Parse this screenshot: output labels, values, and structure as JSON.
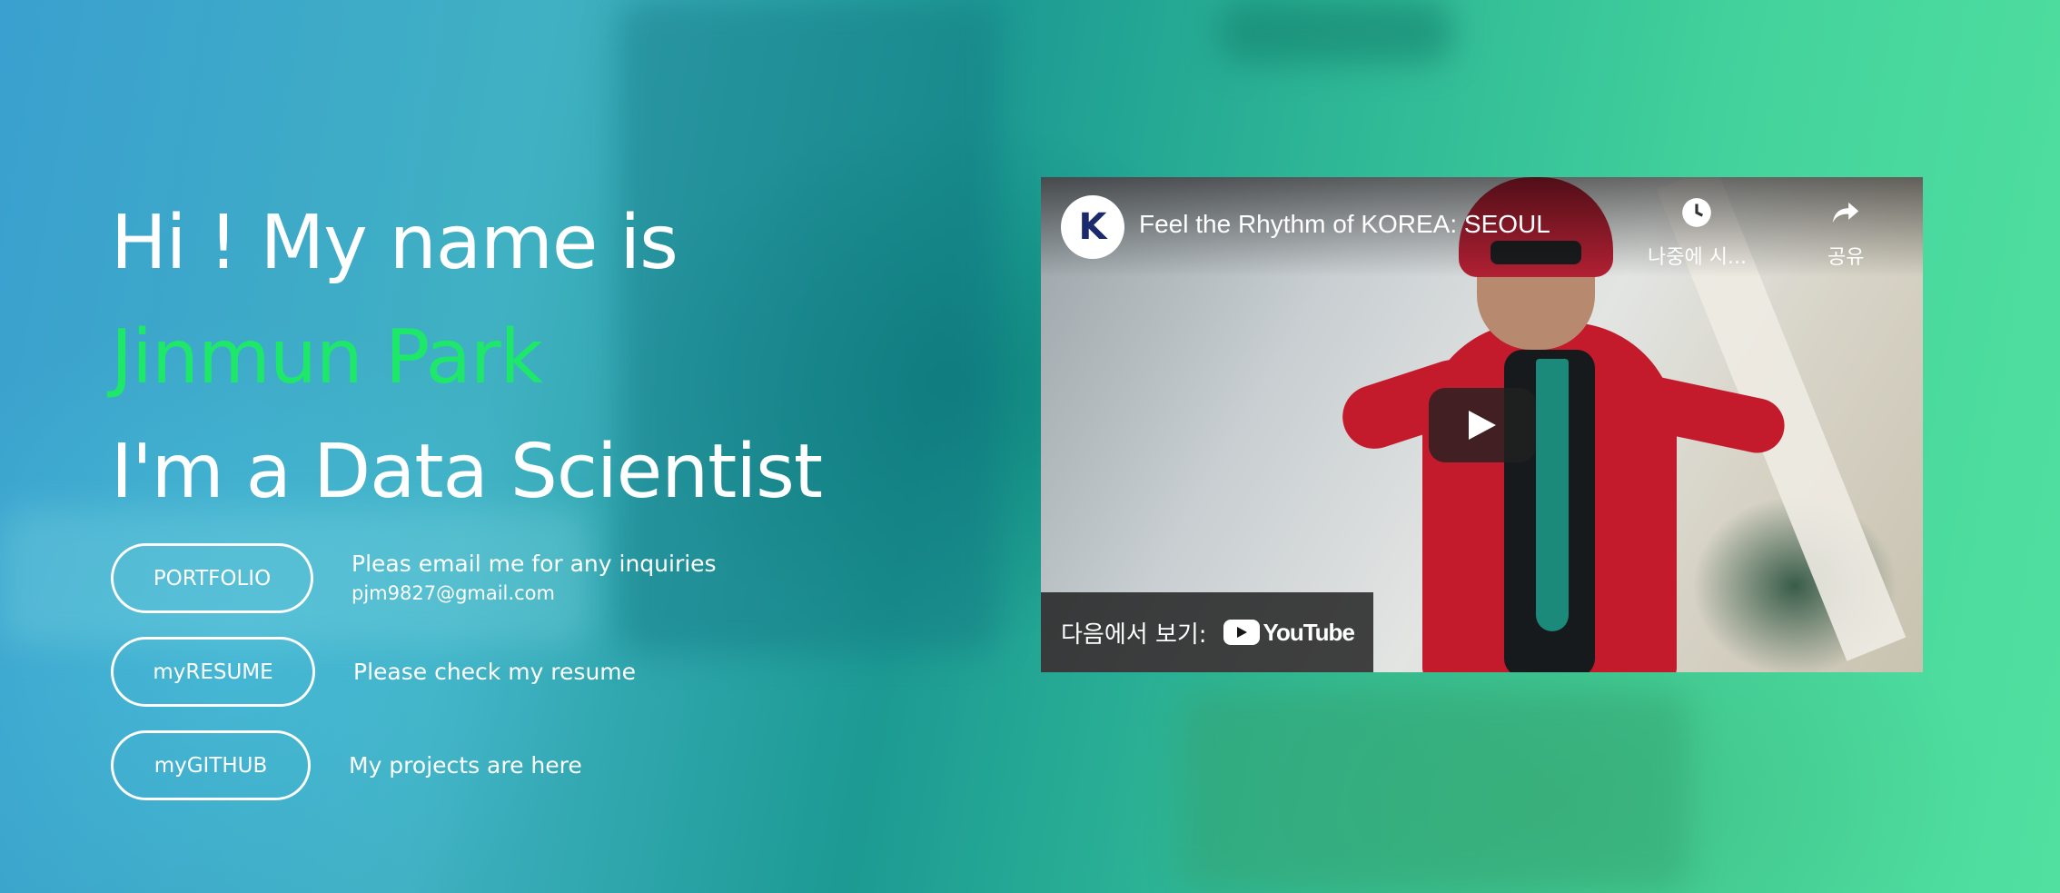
{
  "hero": {
    "greeting": "Hi ! My name is",
    "name": "Jinmun Park",
    "role": "I'm a Data Scientist"
  },
  "actions": [
    {
      "button": "PORTFOLIO",
      "text": "Pleas email me for any inquiries",
      "email": "pjm9827@gmail.com"
    },
    {
      "button": "myRESUME",
      "text": "Please check my resume"
    },
    {
      "button": "myGITHUB",
      "text": "My projects are here"
    }
  ],
  "video": {
    "channel_initial": "K",
    "title": "Feel the Rhythm of KOREA: SEOUL",
    "watch_later": "나중에 시...",
    "share": "공유",
    "watch_on": "다음에서 보기:",
    "youtube": "YouTube"
  },
  "colors": {
    "accent_name": "#1ee86a",
    "text": "#ffffff"
  }
}
